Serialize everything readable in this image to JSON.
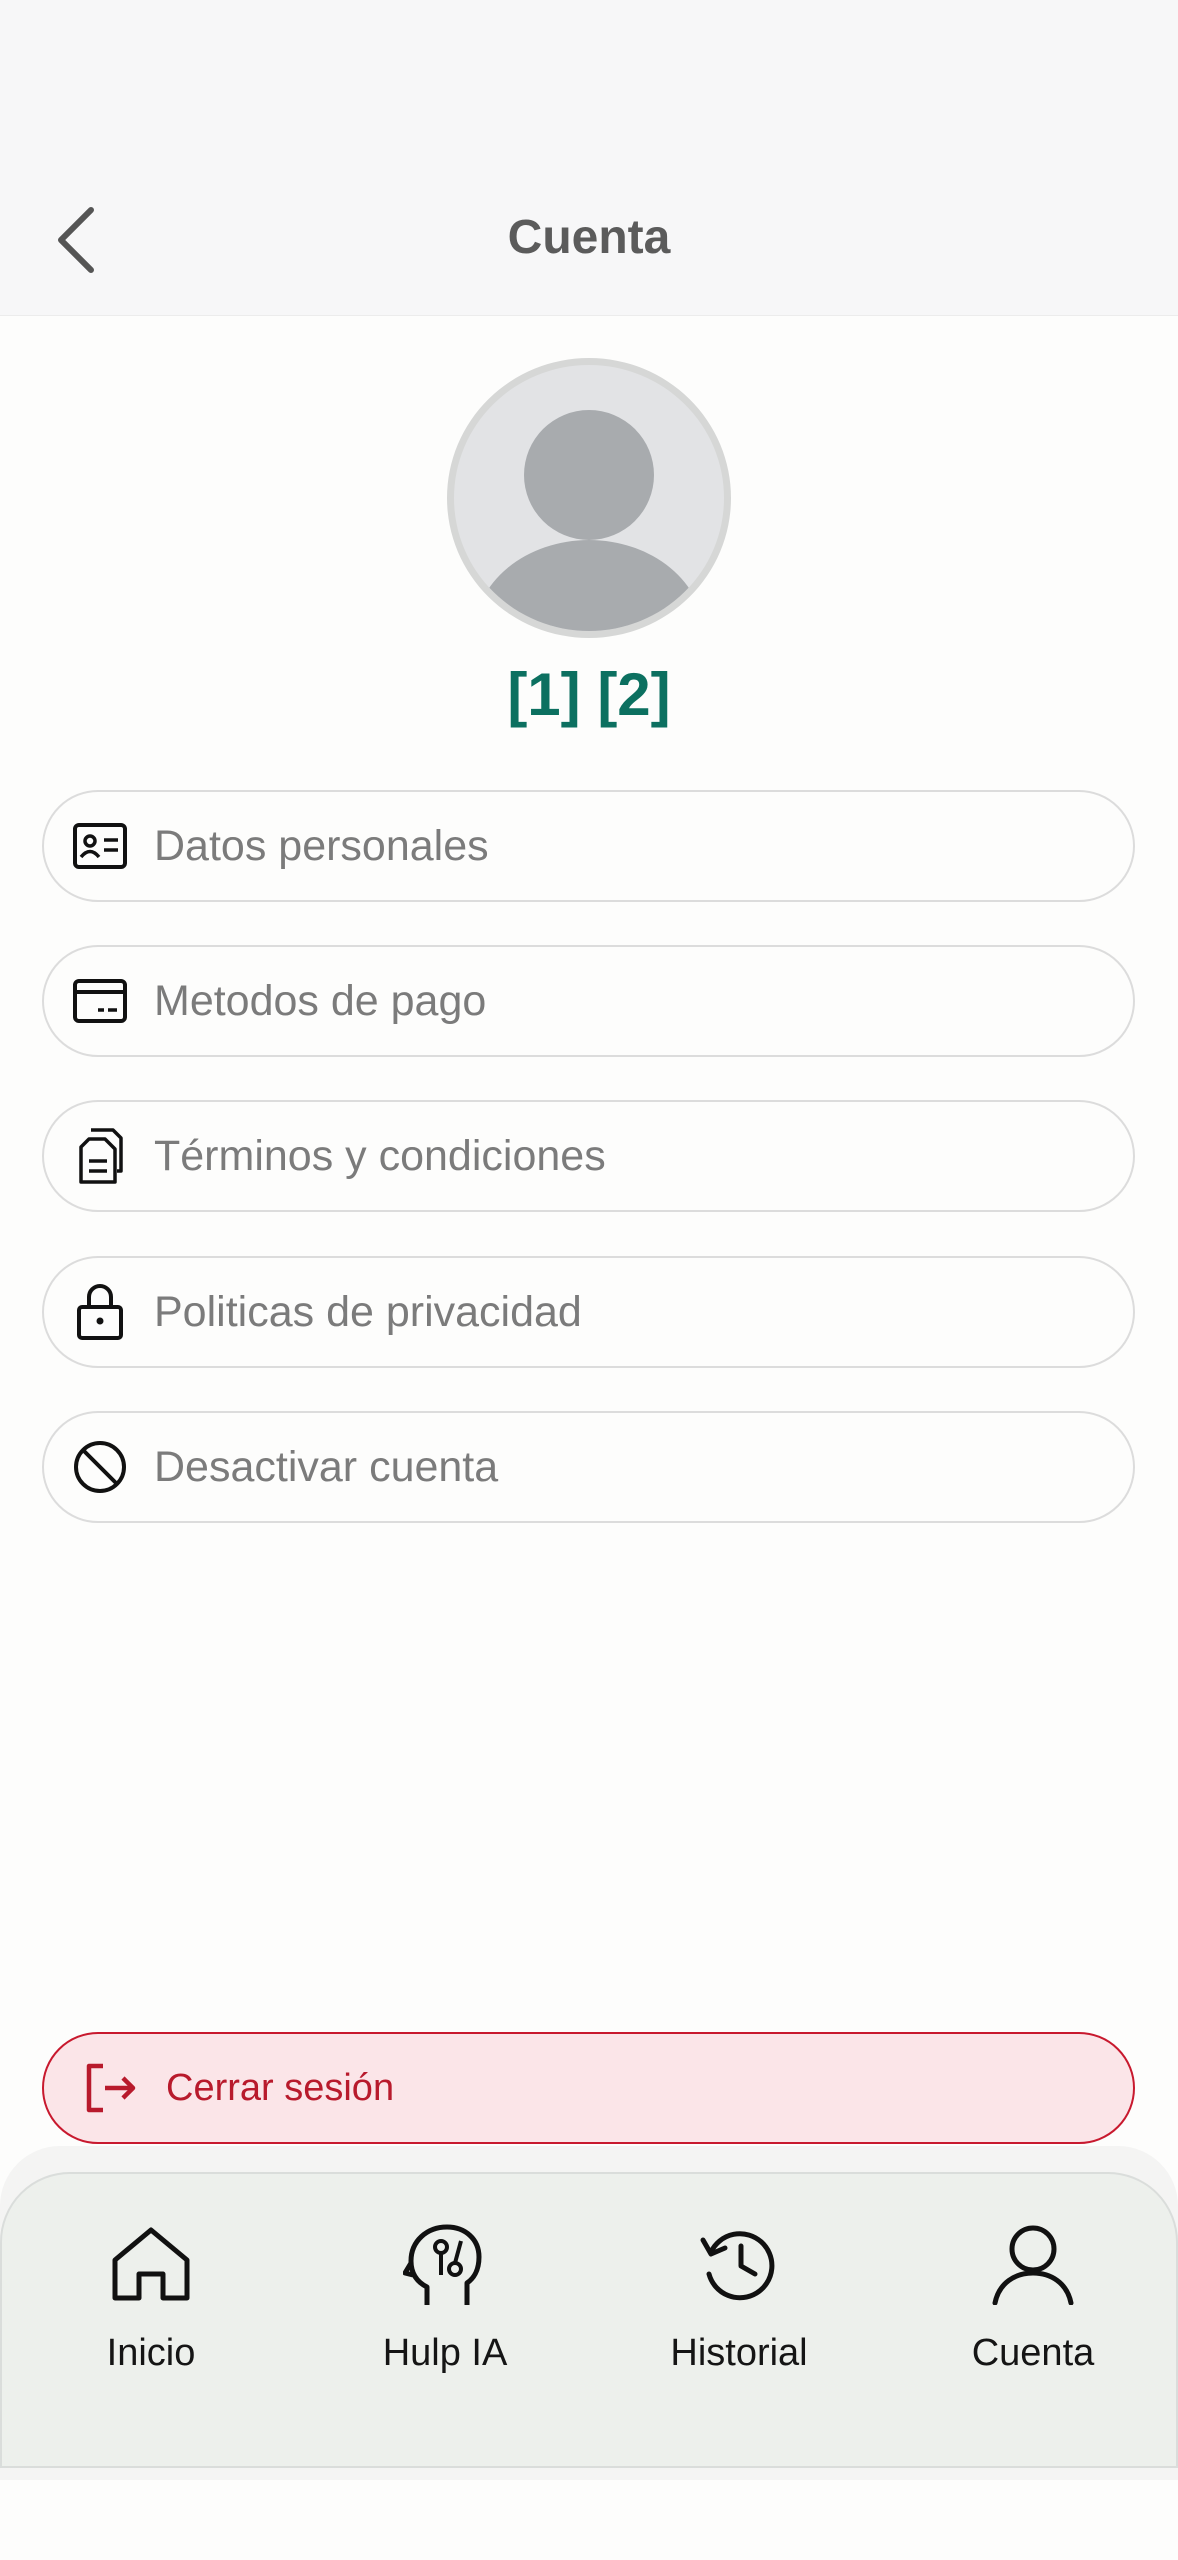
{
  "header": {
    "title": "Cuenta",
    "back_icon": "chevron-left-icon"
  },
  "profile": {
    "avatar_icon": "user-avatar-icon",
    "name": "[1] [2]"
  },
  "menu": [
    {
      "label": "Datos personales",
      "icon": "id-card-icon"
    },
    {
      "label": "Metodos de pago",
      "icon": "credit-card-icon"
    },
    {
      "label": "Términos y condiciones",
      "icon": "documents-icon"
    },
    {
      "label": "Politicas de privacidad",
      "icon": "lock-icon"
    },
    {
      "label": "Desactivar cuenta",
      "icon": "ban-icon"
    }
  ],
  "logout": {
    "label": "Cerrar sesión",
    "icon": "logout-icon"
  },
  "bottom_nav": [
    {
      "label": "Inicio",
      "icon": "home-icon"
    },
    {
      "label": "Hulp IA",
      "icon": "ai-head-icon"
    },
    {
      "label": "Historial",
      "icon": "history-icon"
    },
    {
      "label": "Cuenta",
      "icon": "user-icon"
    }
  ],
  "colors": {
    "accent": "#0c7060",
    "danger": "#b81a2c",
    "danger_bg": "#fbe5e8",
    "nav_bg": "#edf0ec",
    "header_bg": "#f7f7f8"
  }
}
